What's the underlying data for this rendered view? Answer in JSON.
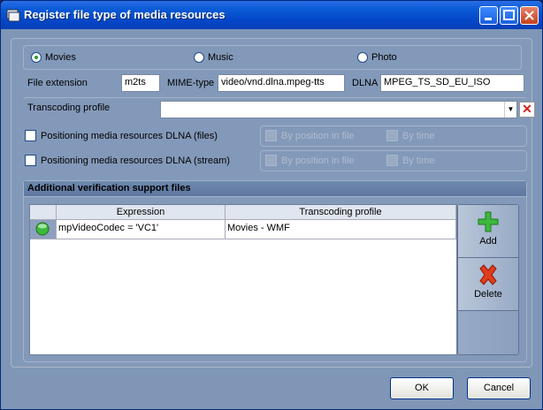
{
  "window": {
    "title": "Register file type of media resources",
    "controls": [
      "minimize",
      "maximize",
      "close"
    ]
  },
  "media_type": {
    "options": [
      {
        "label": "Movies",
        "selected": true
      },
      {
        "label": "Music",
        "selected": false
      },
      {
        "label": "Photo",
        "selected": false
      }
    ]
  },
  "fields": {
    "file_extension_label": "File extension",
    "file_extension_value": "m2ts",
    "mime_label": "MIME-type",
    "mime_value": "video/vnd.dlna.mpeg-tts",
    "dlna_label": "DLNA",
    "dlna_value": "MPEG_TS_SD_EU_ISO",
    "transcoding_label": "Transcoding profile",
    "transcoding_value": ""
  },
  "positioning": {
    "files": {
      "label": "Positioning media resources DLNA (files)",
      "checked": false
    },
    "stream": {
      "label": "Positioning media resources DLNA (stream)",
      "checked": false
    },
    "by_position_label": "By position in file",
    "by_time_label": "By time"
  },
  "verification": {
    "heading": "Additional verification support files",
    "columns": [
      "Expression",
      "Transcoding profile"
    ],
    "rows": [
      {
        "expression": "mpVideoCodec = 'VC1'",
        "profile": "Movies - WMF"
      }
    ],
    "add_label": "Add",
    "delete_label": "Delete"
  },
  "buttons": {
    "ok": "OK",
    "cancel": "Cancel"
  },
  "colors": {
    "titlebar": "#0a5ad6",
    "panel": "#8399b9",
    "add_icon": "#3cb83c",
    "delete_icon": "#e03c1c"
  }
}
